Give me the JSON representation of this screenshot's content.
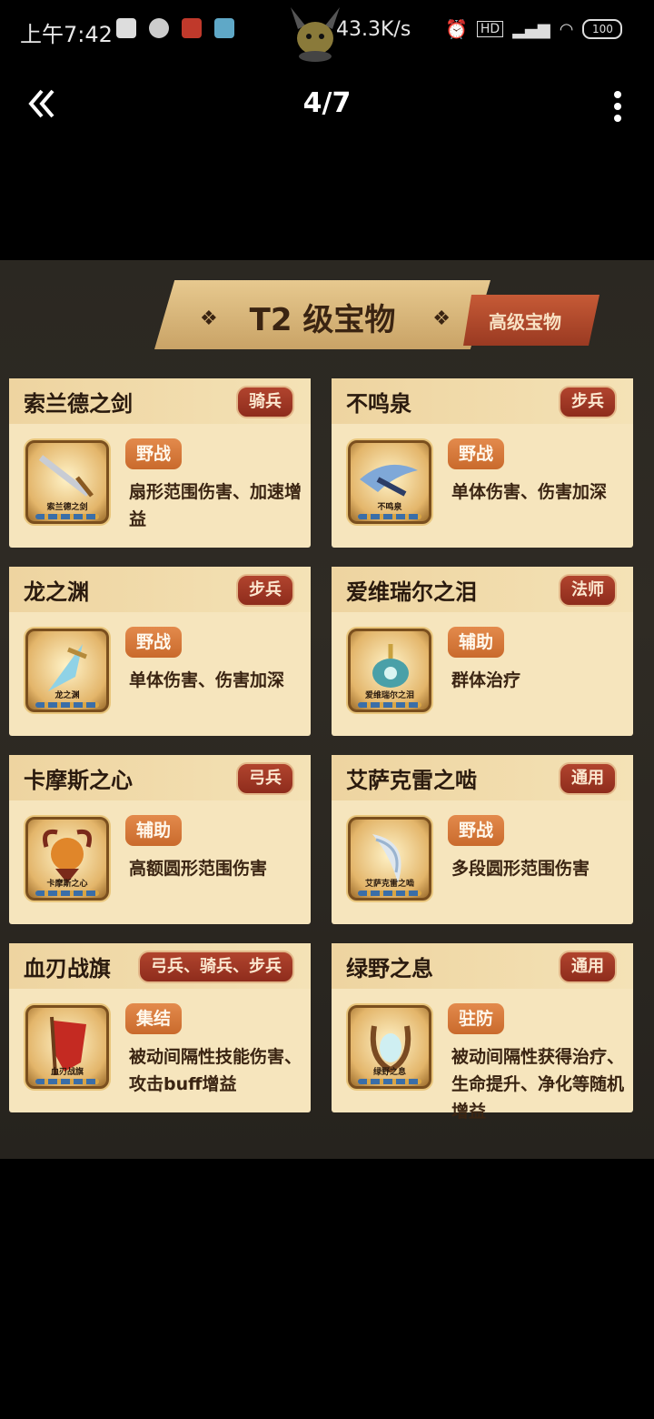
{
  "status_bar": {
    "time": "上午7:42",
    "net_speed": "43.3K/s",
    "battery": "100"
  },
  "nav": {
    "page_indicator": "4/7"
  },
  "banner": {
    "title": "T2 级宝物",
    "tag": "高级宝物"
  },
  "cards": [
    {
      "name": "索兰德之剑",
      "unit": "骑兵",
      "skill": "野战",
      "desc": "扇形范围伤害、加速增益",
      "icon_label": "索兰德之剑",
      "icon": "sword-icon"
    },
    {
      "name": "不鸣泉",
      "unit": "步兵",
      "skill": "野战",
      "desc": "单体伤害、伤害加深",
      "icon_label": "不鸣泉",
      "icon": "blade-icon"
    },
    {
      "name": "龙之渊",
      "unit": "步兵",
      "skill": "野战",
      "desc": "单体伤害、伤害加深",
      "icon_label": "龙之渊",
      "icon": "dagger-icon"
    },
    {
      "name": "爱维瑞尔之泪",
      "unit": "法师",
      "skill": "辅助",
      "desc": "群体治疗",
      "icon_label": "爱维瑞尔之泪",
      "icon": "amulet-icon"
    },
    {
      "name": "卡摩斯之心",
      "unit": "弓兵",
      "skill": "辅助",
      "desc": "高额圆形范围伤害",
      "icon_label": "卡摩斯之心",
      "icon": "heart-orb-icon"
    },
    {
      "name": "艾萨克雷之啮",
      "unit": "通用",
      "skill": "野战",
      "desc": "多段圆形范围伤害",
      "icon_label": "艾萨克雷之啮",
      "icon": "fang-icon"
    },
    {
      "name": "血刃战旗",
      "unit": "弓兵、骑兵、步兵",
      "skill": "集结",
      "desc": "被动间隔性技能伤害、攻击buff增益",
      "icon_label": "血刃战旗",
      "icon": "banner-flag-icon"
    },
    {
      "name": "绿野之息",
      "unit": "通用",
      "skill": "驻防",
      "desc": "被动间隔性获得治疗、生命提升、净化等随机增益",
      "icon_label": "绿野之息",
      "icon": "harp-icon"
    }
  ],
  "colors": {
    "card_bg": "#f6e5bd",
    "unit_badge": "#a33a24",
    "skill_badge": "#d87a3c",
    "text_dark": "#3a2412"
  }
}
